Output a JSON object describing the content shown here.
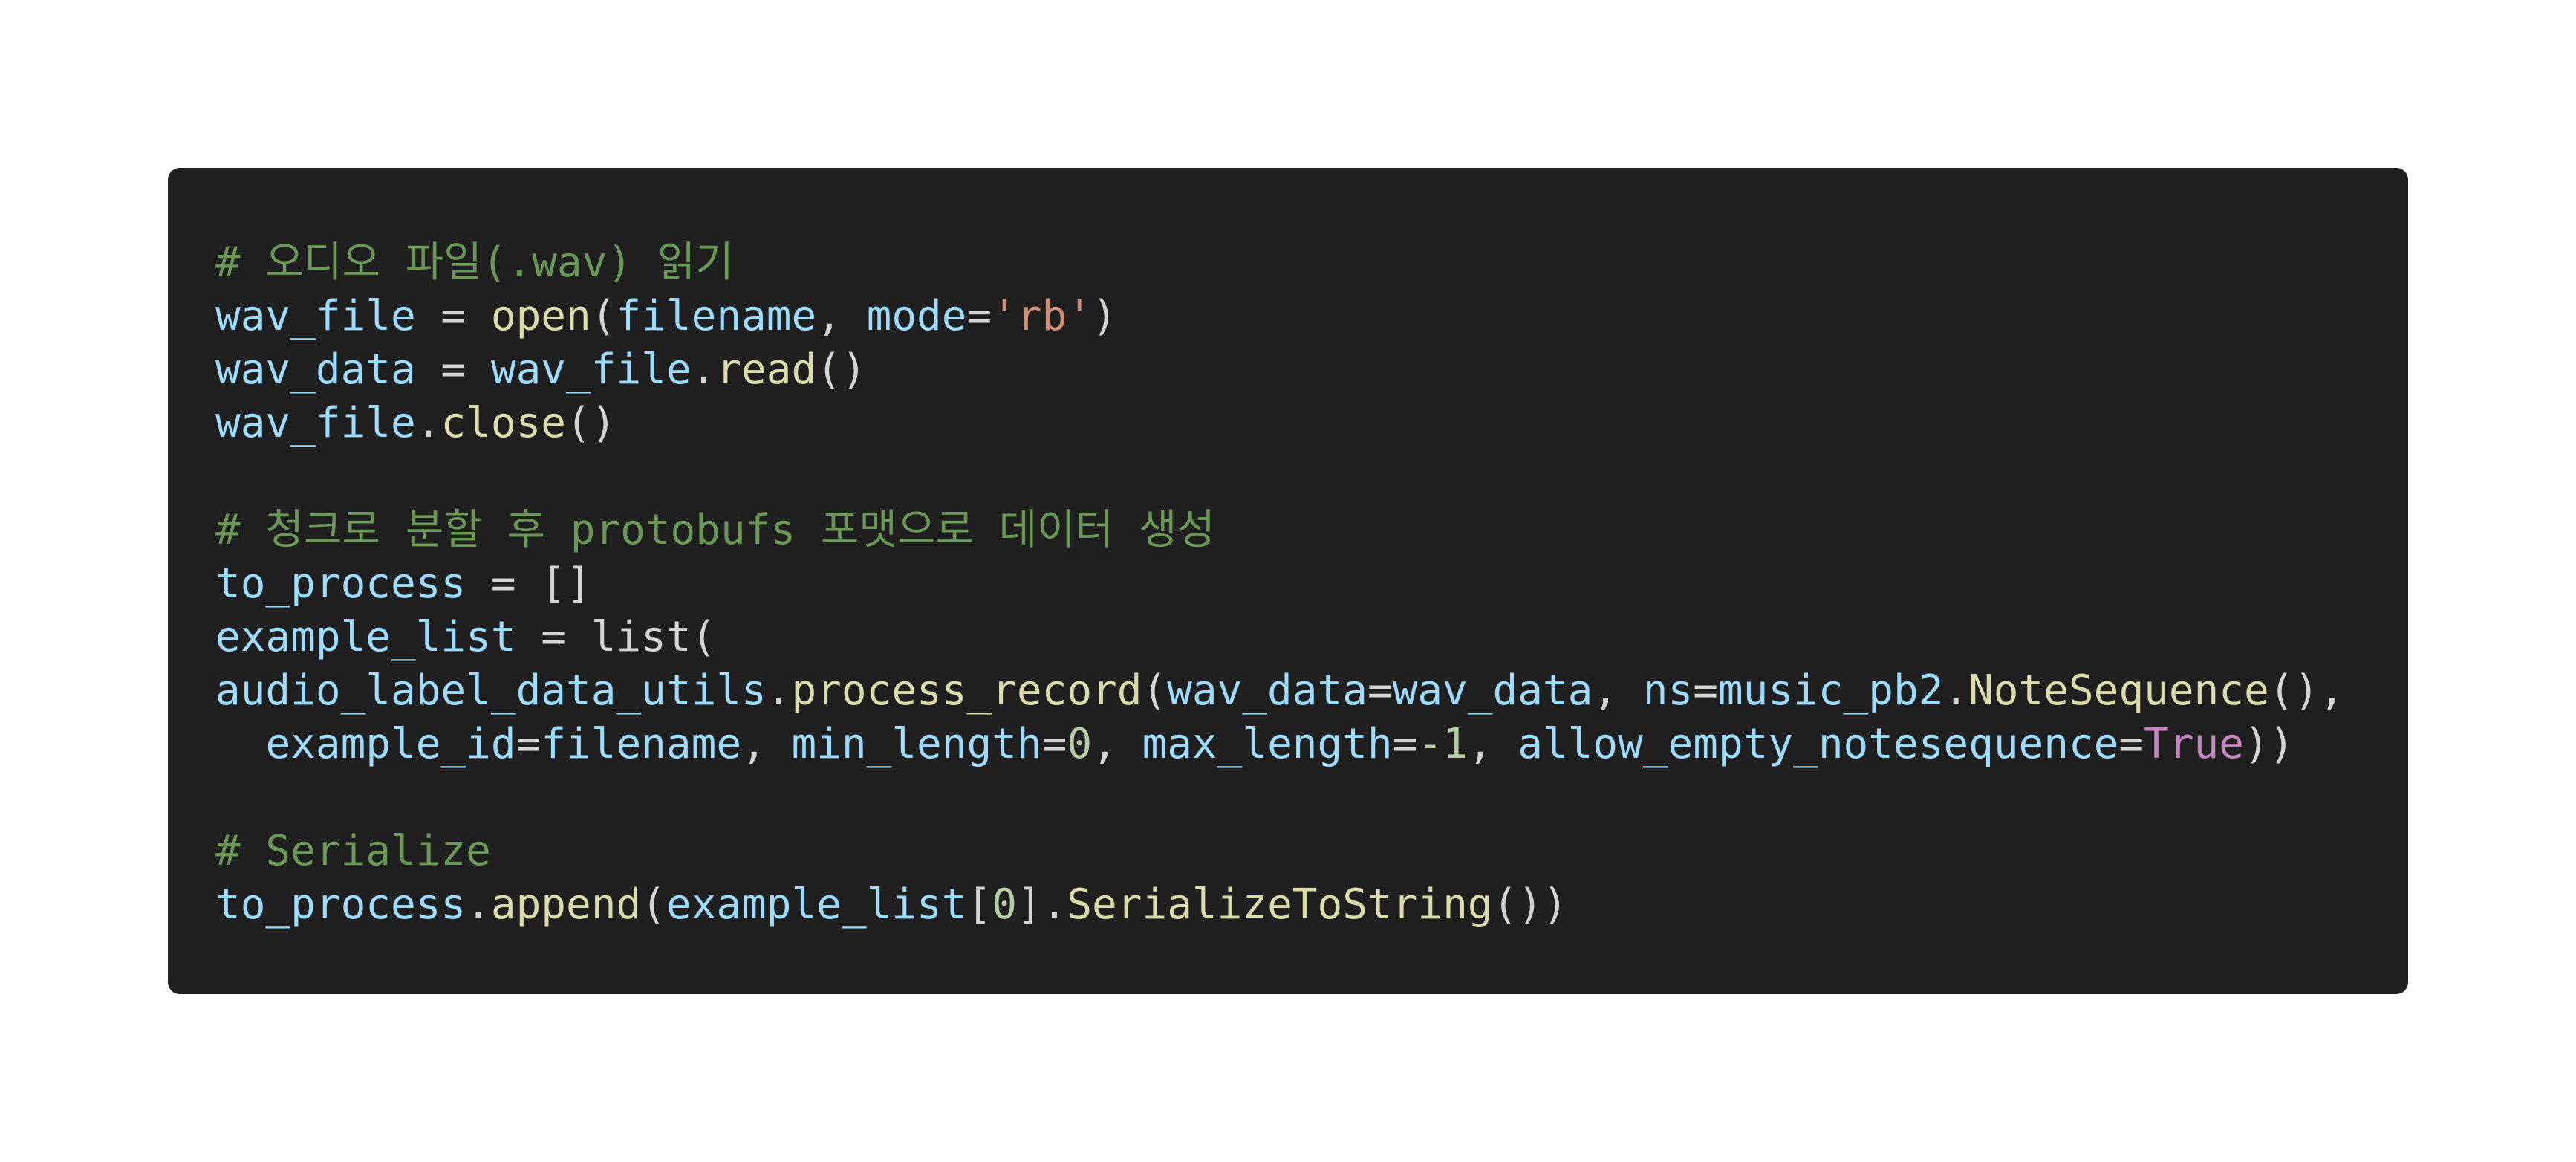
{
  "code": {
    "comment_read": "# 오디오 파일(.wav) 읽기",
    "comment_chunk": "# 청크로 분할 후 protobufs 포맷으로 데이터 생성",
    "comment_serialize": "# Serialize",
    "t": {
      "wav_file": "wav_file",
      "wav_data": "wav_data",
      "eq": " = ",
      "open": "open",
      "filename": "filename",
      "mode": "mode",
      "rb": "'rb'",
      "read": "read",
      "close": "close",
      "to_process": "to_process",
      "empty_list": "[]",
      "example_list": "example_list",
      "list": "list",
      "audio_label_data_utils": "audio_label_data_utils",
      "process_record": "process_record",
      "ns": "ns",
      "music_pb2": "music_pb2",
      "NoteSequence": "NoteSequence",
      "example_id": "example_id",
      "min_length": "min_length",
      "max_length": "max_length",
      "allow_empty_notesequence": "allow_empty_notesequence",
      "zero": "0",
      "neg_one": "-1",
      "true": "True",
      "append": "append",
      "SerializeToString": "SerializeToString"
    }
  }
}
